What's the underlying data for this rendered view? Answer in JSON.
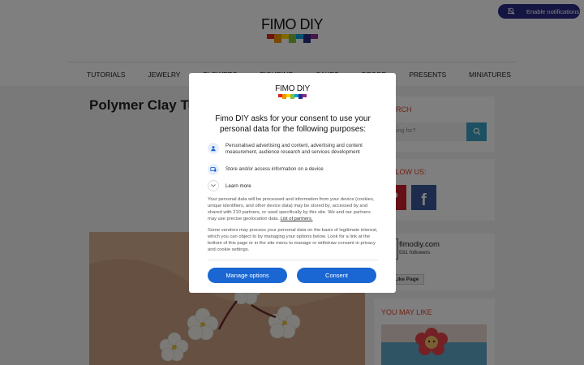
{
  "page": {
    "notifications_label": "Enable notifications",
    "logo_text_light": "FIMO",
    "logo_text_bold": "DIY",
    "nav": [
      "TUTORIALS",
      "JEWELRY",
      "FLOWERS",
      "FIGURINE",
      "CAKES",
      "DECOR",
      "PRESENTS",
      "MINIATURES"
    ],
    "title": "Polymer Clay Tu",
    "search_heading": "SEARCH",
    "search_placeholder": "Looking for?",
    "follow_heading": "FOLLOW US:",
    "fb_name": "fimodiy.com",
    "fb_followers": "531 followers",
    "fb_like_page": "Like Page",
    "you_may_like": "YOU MAY LIKE"
  },
  "consent": {
    "logo_text": "FIMO DIY",
    "heading": "Fimo DIY asks for your consent to use your personal data for the following purposes:",
    "purposes": [
      {
        "icon": "person-icon",
        "text": "Personalised advertising and content, advertising and content measurement, audience research and services development"
      },
      {
        "icon": "device-icon",
        "text": "Store and/or access information on a device"
      }
    ],
    "learn_more": "Learn more",
    "paragraph1": "Your personal data will be processed and information from your device (cookies, unique identifiers, and other device data) may be stored by, accessed by and shared with 210 partners, or used specifically by this site. We and our partners may use precise geolocation data.",
    "partners_link": "List of partners.",
    "paragraph2": "Some vendors may process your personal data on the basis of legitimate interest, which you can object to by managing your options below. Look for a link at the bottom of this page or in the site menu to manage or withdraw consent in privacy and cookie settings.",
    "manage_label": "Manage options",
    "consent_label": "Consent"
  },
  "colors": {
    "primary_button": "#1a66d2",
    "accent_heading": "#e0452c",
    "notification_pill": "#2b2b87"
  }
}
